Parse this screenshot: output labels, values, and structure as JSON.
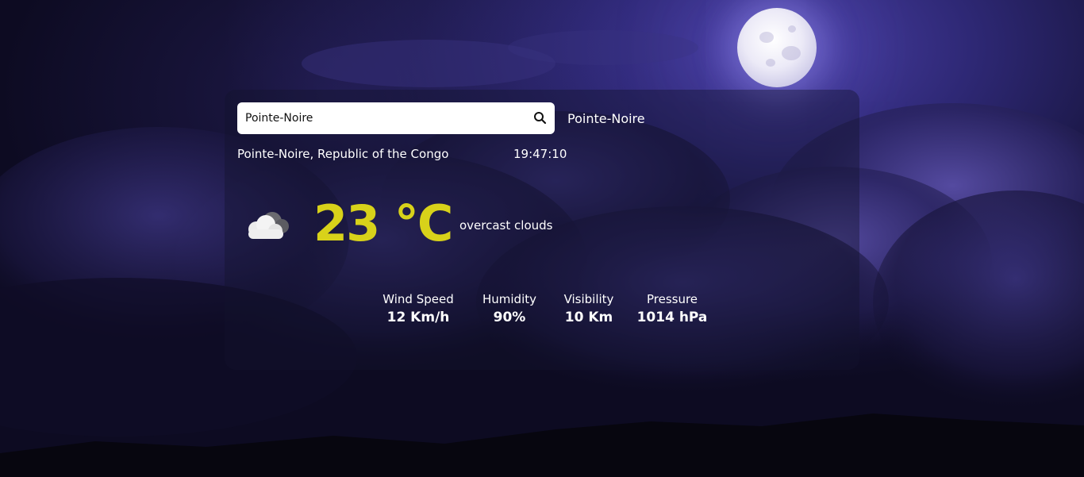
{
  "search": {
    "value": "Pointe-Noire",
    "icon": "search-icon"
  },
  "header": {
    "city": "Pointe-Noire"
  },
  "location": {
    "place": "Pointe-Noire, Republic of the Congo",
    "time": "19:47:10"
  },
  "current": {
    "icon": "cloud-icon",
    "temperature": "23 °C",
    "description": "overcast clouds"
  },
  "stats": [
    {
      "label": "Wind Speed",
      "value": "12 Km/h"
    },
    {
      "label": "Humidity",
      "value": "90%"
    },
    {
      "label": "Visibility",
      "value": "10 Km"
    },
    {
      "label": "Pressure",
      "value": "1014 hPa"
    }
  ],
  "colors": {
    "temperature": "#d8d21a",
    "card_background": "rgba(20,18,45,0.42)",
    "sky": "#2e2875"
  }
}
